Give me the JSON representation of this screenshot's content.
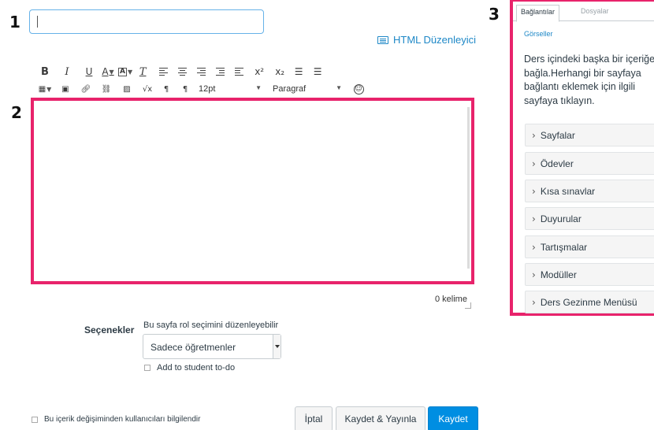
{
  "callouts": {
    "one": "1",
    "two": "2",
    "three": "3"
  },
  "title_input": {
    "value": ""
  },
  "html_editor": {
    "label": "HTML Düzenleyici",
    "icon": "keyboard-icon"
  },
  "toolbar": {
    "row1": {
      "bold": "B",
      "italic": "I",
      "underline": "U",
      "font_color": "A",
      "highlight": "A",
      "clear_format": "T",
      "superscript": "x²",
      "subscript": "x₂",
      "bullets": "☰",
      "numbered": "☰"
    },
    "row2": {
      "font_size": "12pt",
      "block_format": "Paragraf",
      "sqrt": "√x",
      "ltr": "¶",
      "rtl": "¶"
    }
  },
  "editor": {
    "word_count": "0 kelime"
  },
  "options": {
    "label": "Seçenekler",
    "hint": "Bu sayfa rol seçimini düzenleyebilir",
    "role_select": "Sadece öğretmenler",
    "todo_label": "Add to student to-do"
  },
  "footer": {
    "notify_label": "Bu içerik değişiminden kullanıcıları bilgilendir",
    "cancel": "İptal",
    "save_publish": "Kaydet & Yayınla",
    "save": "Kaydet"
  },
  "side_panel": {
    "tabs": [
      "Bağlantılar",
      "Dosyalar",
      "Görseller"
    ],
    "description": "Ders içindeki başka bir içeriğe bağla.Herhangi bir sayfaya bağlantı eklemek için ilgili sayfaya tıklayın.",
    "sections": [
      "Sayfalar",
      "Ödevler",
      "Kısa sınavlar",
      "Duyurular",
      "Tartışmalar",
      "Modüller",
      "Ders Gezinme Menüsü"
    ]
  },
  "colors": {
    "highlight_border": "#e8236b",
    "primary": "#008ee2",
    "link": "#1e88c7"
  }
}
